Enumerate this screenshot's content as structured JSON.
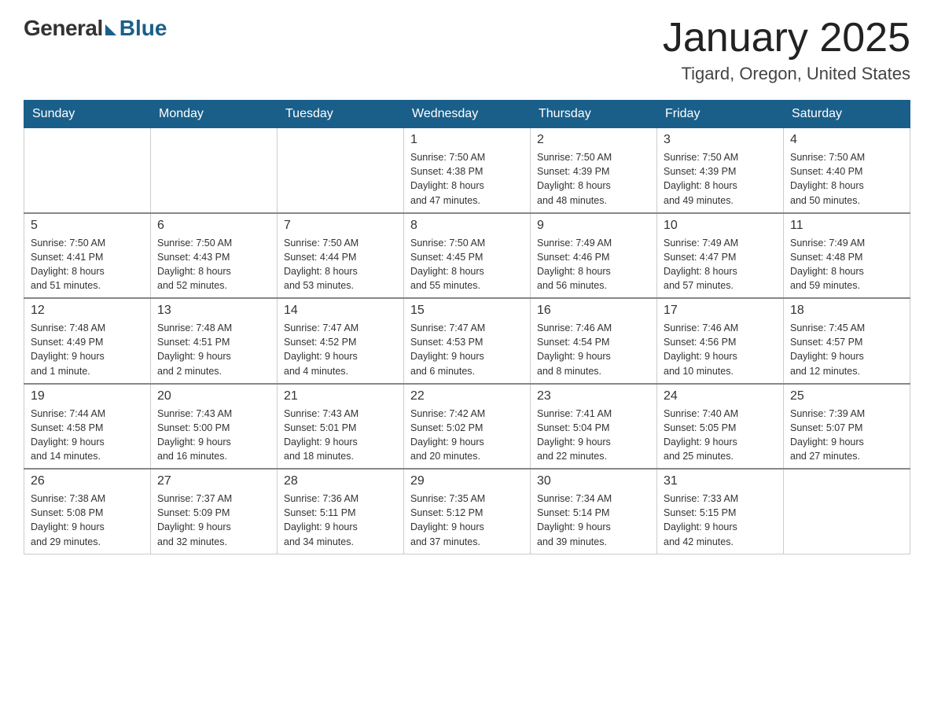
{
  "header": {
    "logo": {
      "general": "General",
      "blue": "Blue"
    },
    "title": "January 2025",
    "location": "Tigard, Oregon, United States"
  },
  "calendar": {
    "days_of_week": [
      "Sunday",
      "Monday",
      "Tuesday",
      "Wednesday",
      "Thursday",
      "Friday",
      "Saturday"
    ],
    "weeks": [
      [
        {
          "day": "",
          "info": ""
        },
        {
          "day": "",
          "info": ""
        },
        {
          "day": "",
          "info": ""
        },
        {
          "day": "1",
          "info": "Sunrise: 7:50 AM\nSunset: 4:38 PM\nDaylight: 8 hours\nand 47 minutes."
        },
        {
          "day": "2",
          "info": "Sunrise: 7:50 AM\nSunset: 4:39 PM\nDaylight: 8 hours\nand 48 minutes."
        },
        {
          "day": "3",
          "info": "Sunrise: 7:50 AM\nSunset: 4:39 PM\nDaylight: 8 hours\nand 49 minutes."
        },
        {
          "day": "4",
          "info": "Sunrise: 7:50 AM\nSunset: 4:40 PM\nDaylight: 8 hours\nand 50 minutes."
        }
      ],
      [
        {
          "day": "5",
          "info": "Sunrise: 7:50 AM\nSunset: 4:41 PM\nDaylight: 8 hours\nand 51 minutes."
        },
        {
          "day": "6",
          "info": "Sunrise: 7:50 AM\nSunset: 4:43 PM\nDaylight: 8 hours\nand 52 minutes."
        },
        {
          "day": "7",
          "info": "Sunrise: 7:50 AM\nSunset: 4:44 PM\nDaylight: 8 hours\nand 53 minutes."
        },
        {
          "day": "8",
          "info": "Sunrise: 7:50 AM\nSunset: 4:45 PM\nDaylight: 8 hours\nand 55 minutes."
        },
        {
          "day": "9",
          "info": "Sunrise: 7:49 AM\nSunset: 4:46 PM\nDaylight: 8 hours\nand 56 minutes."
        },
        {
          "day": "10",
          "info": "Sunrise: 7:49 AM\nSunset: 4:47 PM\nDaylight: 8 hours\nand 57 minutes."
        },
        {
          "day": "11",
          "info": "Sunrise: 7:49 AM\nSunset: 4:48 PM\nDaylight: 8 hours\nand 59 minutes."
        }
      ],
      [
        {
          "day": "12",
          "info": "Sunrise: 7:48 AM\nSunset: 4:49 PM\nDaylight: 9 hours\nand 1 minute."
        },
        {
          "day": "13",
          "info": "Sunrise: 7:48 AM\nSunset: 4:51 PM\nDaylight: 9 hours\nand 2 minutes."
        },
        {
          "day": "14",
          "info": "Sunrise: 7:47 AM\nSunset: 4:52 PM\nDaylight: 9 hours\nand 4 minutes."
        },
        {
          "day": "15",
          "info": "Sunrise: 7:47 AM\nSunset: 4:53 PM\nDaylight: 9 hours\nand 6 minutes."
        },
        {
          "day": "16",
          "info": "Sunrise: 7:46 AM\nSunset: 4:54 PM\nDaylight: 9 hours\nand 8 minutes."
        },
        {
          "day": "17",
          "info": "Sunrise: 7:46 AM\nSunset: 4:56 PM\nDaylight: 9 hours\nand 10 minutes."
        },
        {
          "day": "18",
          "info": "Sunrise: 7:45 AM\nSunset: 4:57 PM\nDaylight: 9 hours\nand 12 minutes."
        }
      ],
      [
        {
          "day": "19",
          "info": "Sunrise: 7:44 AM\nSunset: 4:58 PM\nDaylight: 9 hours\nand 14 minutes."
        },
        {
          "day": "20",
          "info": "Sunrise: 7:43 AM\nSunset: 5:00 PM\nDaylight: 9 hours\nand 16 minutes."
        },
        {
          "day": "21",
          "info": "Sunrise: 7:43 AM\nSunset: 5:01 PM\nDaylight: 9 hours\nand 18 minutes."
        },
        {
          "day": "22",
          "info": "Sunrise: 7:42 AM\nSunset: 5:02 PM\nDaylight: 9 hours\nand 20 minutes."
        },
        {
          "day": "23",
          "info": "Sunrise: 7:41 AM\nSunset: 5:04 PM\nDaylight: 9 hours\nand 22 minutes."
        },
        {
          "day": "24",
          "info": "Sunrise: 7:40 AM\nSunset: 5:05 PM\nDaylight: 9 hours\nand 25 minutes."
        },
        {
          "day": "25",
          "info": "Sunrise: 7:39 AM\nSunset: 5:07 PM\nDaylight: 9 hours\nand 27 minutes."
        }
      ],
      [
        {
          "day": "26",
          "info": "Sunrise: 7:38 AM\nSunset: 5:08 PM\nDaylight: 9 hours\nand 29 minutes."
        },
        {
          "day": "27",
          "info": "Sunrise: 7:37 AM\nSunset: 5:09 PM\nDaylight: 9 hours\nand 32 minutes."
        },
        {
          "day": "28",
          "info": "Sunrise: 7:36 AM\nSunset: 5:11 PM\nDaylight: 9 hours\nand 34 minutes."
        },
        {
          "day": "29",
          "info": "Sunrise: 7:35 AM\nSunset: 5:12 PM\nDaylight: 9 hours\nand 37 minutes."
        },
        {
          "day": "30",
          "info": "Sunrise: 7:34 AM\nSunset: 5:14 PM\nDaylight: 9 hours\nand 39 minutes."
        },
        {
          "day": "31",
          "info": "Sunrise: 7:33 AM\nSunset: 5:15 PM\nDaylight: 9 hours\nand 42 minutes."
        },
        {
          "day": "",
          "info": ""
        }
      ]
    ]
  }
}
